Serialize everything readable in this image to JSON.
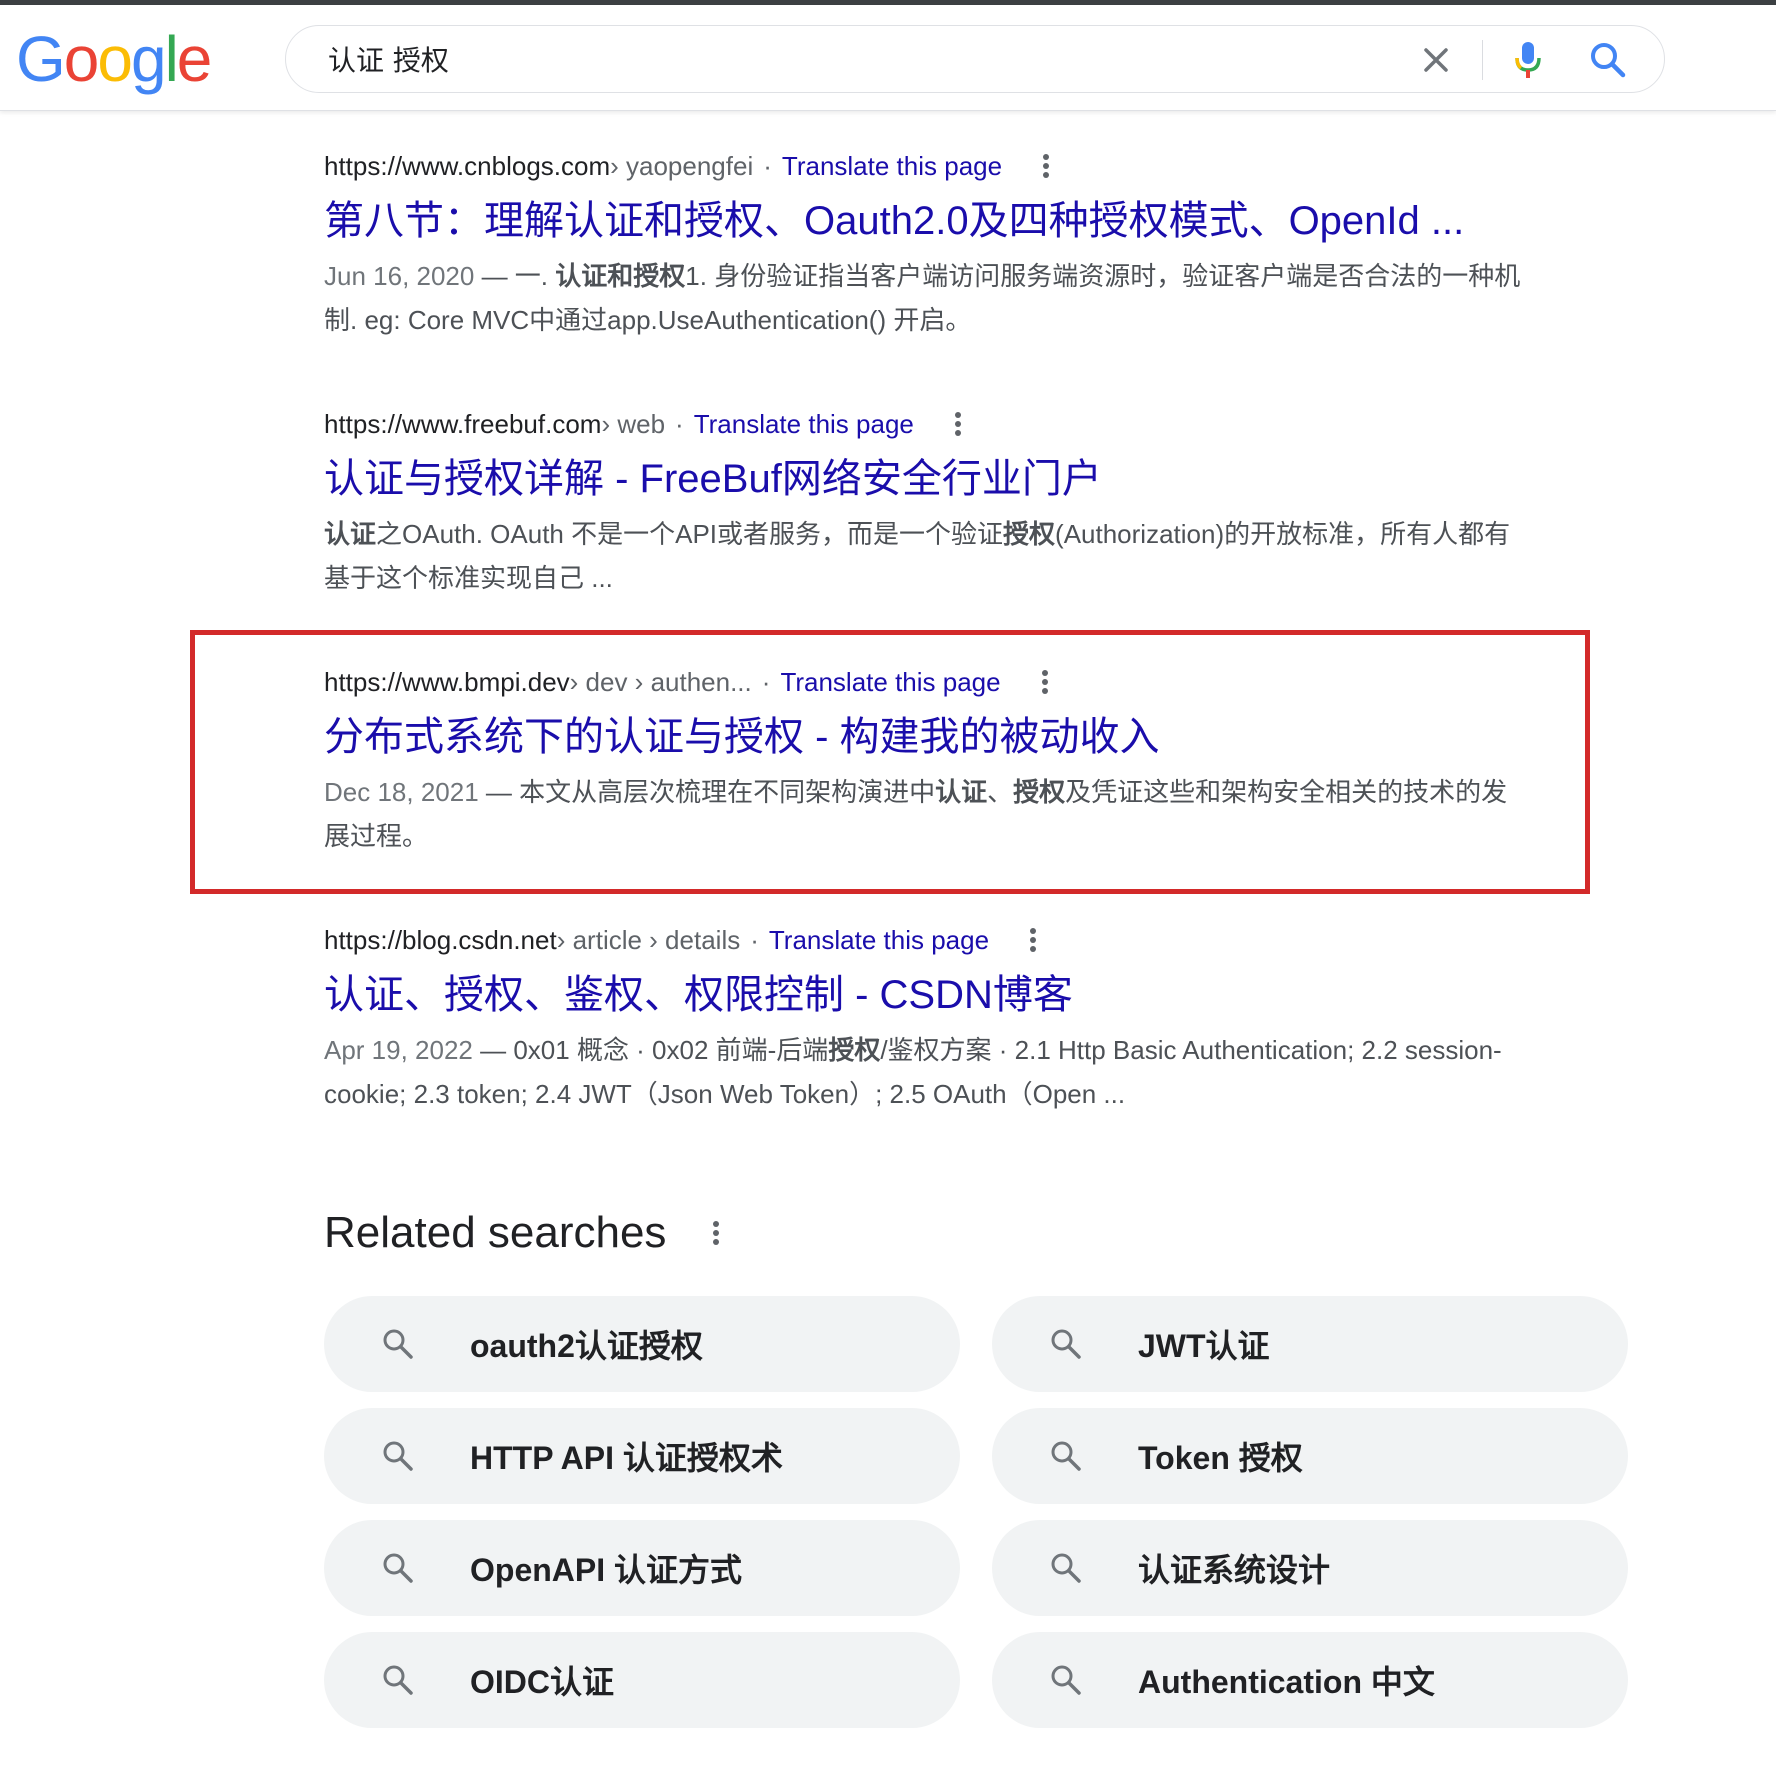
{
  "header": {
    "logo_letters": [
      {
        "ch": "G",
        "color": "#4285F4"
      },
      {
        "ch": "o",
        "color": "#EA4335"
      },
      {
        "ch": "o",
        "color": "#FBBC05"
      },
      {
        "ch": "g",
        "color": "#4285F4"
      },
      {
        "ch": "l",
        "color": "#34A853"
      },
      {
        "ch": "e",
        "color": "#EA4335"
      }
    ],
    "search_value": "认证 授权",
    "icons": {
      "clear": "close-icon",
      "mic": "microphone-icon",
      "search": "search-icon"
    }
  },
  "results": [
    {
      "site": "https://www.cnblogs.com",
      "path": " › yaopengfei",
      "translate": "Translate this page",
      "title": "第八节：理解认证和授权、Oauth2.0及四种授权模式、OpenId ...",
      "date": "Jun 16, 2020",
      "snippet": [
        {
          "t": " — 一. ",
          "b": false
        },
        {
          "t": "认证和授权",
          "b": true
        },
        {
          "t": "1. 身份验证指当客户端访问服务端资源时，验证客户端是否合法的一种机制. eg: Core MVC中通过app.UseAuthentication() 开启。",
          "b": false
        }
      ]
    },
    {
      "site": "https://www.freebuf.com",
      "path": " › web",
      "translate": "Translate this page",
      "title": "认证与授权详解 - FreeBuf网络安全行业门户",
      "date": "",
      "snippet": [
        {
          "t": "认证",
          "b": true
        },
        {
          "t": "之OAuth. OAuth 不是一个API或者服务，而是一个验证",
          "b": false
        },
        {
          "t": "授权",
          "b": true
        },
        {
          "t": "(Authorization)的开放标准，所有人都有基于这个标准实现自己 ...",
          "b": false
        }
      ]
    },
    {
      "site": "https://www.bmpi.dev",
      "path": " › dev › authen...",
      "translate": "Translate this page",
      "title": "分布式系统下的认证与授权 - 构建我的被动收入",
      "date": "Dec 18, 2021",
      "snippet": [
        {
          "t": " — 本文从高层次梳理在不同架构演进中",
          "b": false
        },
        {
          "t": "认证",
          "b": true
        },
        {
          "t": "、",
          "b": false
        },
        {
          "t": "授权",
          "b": true
        },
        {
          "t": "及凭证这些和架构安全相关的技术的发展过程。",
          "b": false
        }
      ]
    },
    {
      "site": "https://blog.csdn.net",
      "path": " › article › details",
      "translate": "Translate this page",
      "title": "认证、授权、鉴权、权限控制 - CSDN博客",
      "date": "Apr 19, 2022",
      "snippet": [
        {
          "t": " — 0x01 概念 · 0x02 前端-后端",
          "b": false
        },
        {
          "t": "授权",
          "b": true
        },
        {
          "t": "/鉴权方案 · 2.1 Http Basic Authentication; 2.2 session-cookie; 2.3 token; 2.4 JWT（Json Web Token）; 2.5 OAuth（Open ...",
          "b": false
        }
      ]
    }
  ],
  "related": {
    "title": "Related searches",
    "items": [
      "oauth2认证授权",
      "JWT认证",
      "HTTP API 认证授权术",
      "Token 授权",
      "OpenAPI 认证方式",
      "认证系统设计",
      "OIDC认证",
      "Authentication 中文"
    ]
  },
  "colors": {
    "link": "#1a0dab",
    "highlight_border": "#d32a2a",
    "chip_bg": "#f1f3f4"
  }
}
